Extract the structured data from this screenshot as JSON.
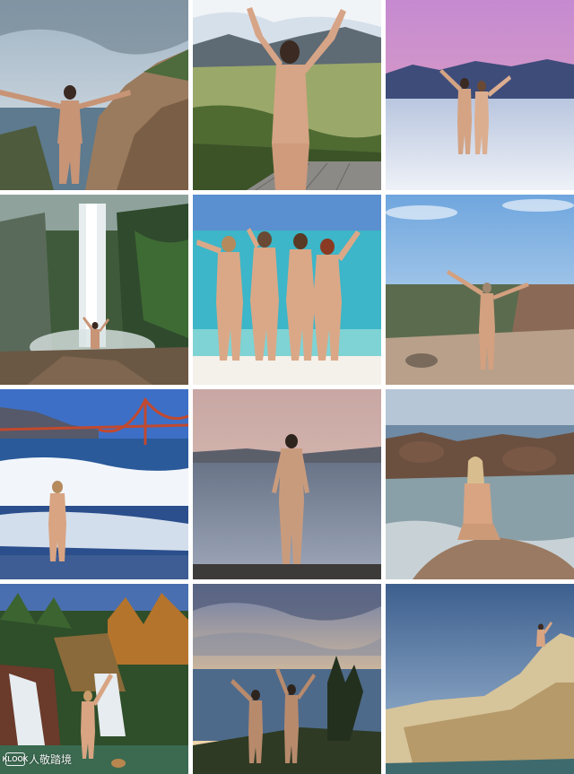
{
  "collage": {
    "tiles": [
      {
        "scene": "rocky-cliff-over-ocean",
        "subjects": 1
      },
      {
        "scene": "mountain-valley-boardwalk",
        "subjects": 1
      },
      {
        "scene": "salt-flat-at-sunset",
        "subjects": 2
      },
      {
        "scene": "jungle-waterfall",
        "subjects": 1
      },
      {
        "scene": "tropical-beach",
        "subjects": 4
      },
      {
        "scene": "canyon-overlook",
        "subjects": 1
      },
      {
        "scene": "golden-gate-bridge-beach",
        "subjects": 1
      },
      {
        "scene": "dusk-lake-shore",
        "subjects": 1
      },
      {
        "scene": "rocky-tide-pools",
        "subjects": 1
      },
      {
        "scene": "autumn-waterfall",
        "subjects": 1
      },
      {
        "scene": "sunset-headland",
        "subjects": 2
      },
      {
        "scene": "sea-cliff-rock",
        "subjects": 1
      }
    ]
  },
  "watermark": {
    "logo": "KLOOK",
    "text": "人敬踏境"
  },
  "colors": {
    "sky_blue": "#5a8fd0",
    "sea_teal": "#3cb6c8",
    "sunset_pink": "#c58ad0",
    "skin": "#d9a98a"
  }
}
